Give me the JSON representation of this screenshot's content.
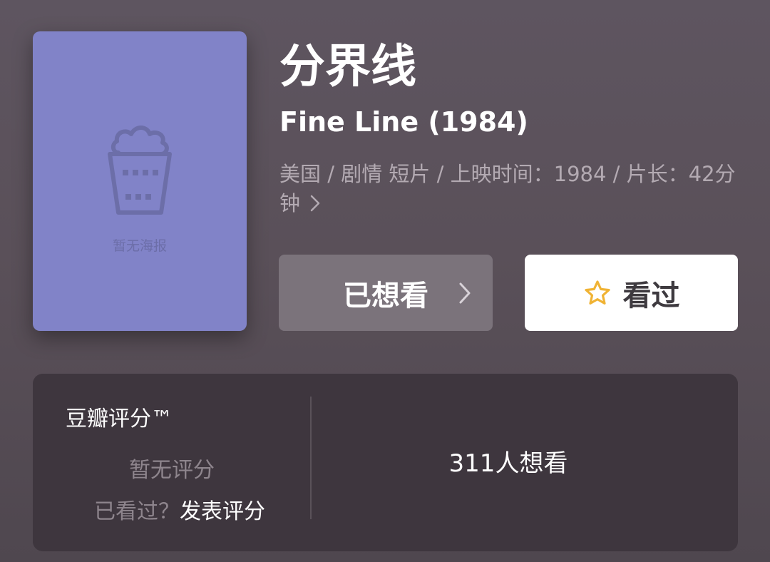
{
  "poster": {
    "placeholder_text": "暂无海报",
    "icon": "popcorn-bucket-icon",
    "background": "#8183c8"
  },
  "movie": {
    "title": "分界线",
    "original_title": "Fine Line (1984)",
    "meta_line": "美国 / 剧情 短片 / 上映时间：1984 / 片长：42分钟"
  },
  "actions": {
    "wish_label": "已想看",
    "watched_label": "看过",
    "watched_icon": "star-outline-icon",
    "star_color": "#f0b334"
  },
  "rating": {
    "label": "豆瓣评分™",
    "no_rating_text": "暂无评分",
    "watched_prompt": "已看过？",
    "rate_link": "发表评分",
    "wish_count": "311人想看"
  }
}
